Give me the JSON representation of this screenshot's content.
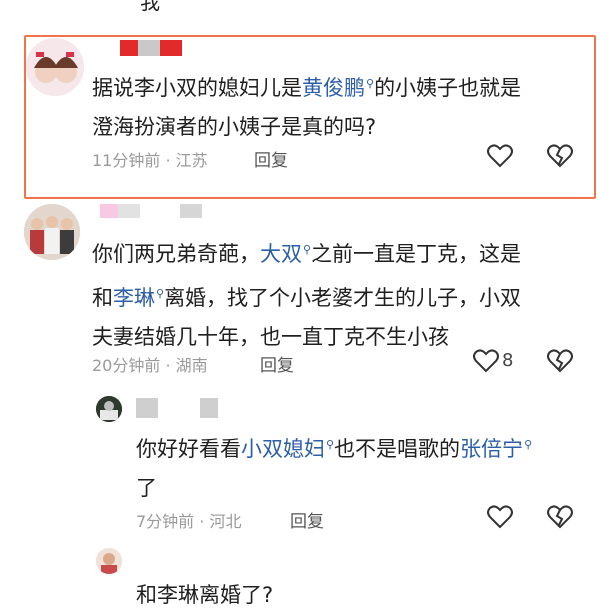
{
  "top_fragment": "我",
  "comments": [
    {
      "segments": [
        {
          "text": "据说李小双的媳妇儿是",
          "link": false
        },
        {
          "text": "黄俊鹏",
          "link": true
        },
        {
          "text": "的小姨子也就是",
          "link": false
        }
      ],
      "line2": "澄海扮演者的小姨子是真的吗?",
      "time_location": "11分钟前 · 江苏",
      "reply_label": "回复",
      "like_count": ""
    },
    {
      "line1": [
        {
          "text": "你们两兄弟奇葩，",
          "link": false
        },
        {
          "text": "大双",
          "link": true
        },
        {
          "text": "之前一直是丁克，这是",
          "link": false
        }
      ],
      "line2": [
        {
          "text": "和",
          "link": false
        },
        {
          "text": "李琳",
          "link": true
        },
        {
          "text": "离婚，找了个小老婆才生的儿子，小双",
          "link": false
        }
      ],
      "line3": "夫妻结婚几十年，也一直丁克不生小孩",
      "time_location": "20分钟前 · 湖南",
      "reply_label": "回复",
      "like_count": "8"
    },
    {
      "line1": [
        {
          "text": "你好好看看",
          "link": false
        },
        {
          "text": "小双媳妇",
          "link": true
        },
        {
          "text": "也不是唱歌的",
          "link": false
        },
        {
          "text": "张倍宁",
          "link": true
        }
      ],
      "line2": "了",
      "time_location": "7分钟前 · 河北",
      "reply_label": "回复",
      "like_count": ""
    },
    {
      "line1": "和李琳离婚了?"
    }
  ],
  "colors": {
    "highlight_border": "#f0744a",
    "link": "#2d5ea8",
    "meta": "#9a9a9a"
  },
  "icons": [
    "like-heart-icon",
    "dislike-broken-heart-icon",
    "search-mini-icon"
  ]
}
